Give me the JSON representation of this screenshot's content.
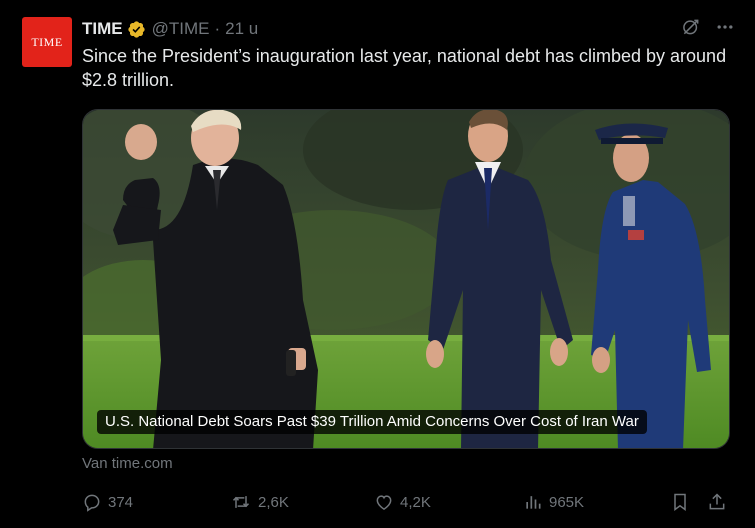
{
  "account": {
    "avatar_text": "TIME",
    "display_name": "TIME",
    "handle": "@TIME",
    "separator": "·",
    "time_ago": "21 u",
    "brand_color": "#e2231a",
    "verified_color": "#e8b829"
  },
  "header_actions": {
    "grok_icon": "grok-icon",
    "more_icon": "more-icon"
  },
  "tweet": {
    "text": "Since the President’s inauguration last year, national debt has climbed by around $2.8 trillion."
  },
  "card": {
    "caption": "U.S. National Debt Soars Past $39 Trillion Amid Concerns Over Cost of Iran War",
    "source": "Van time.com"
  },
  "actions": {
    "replies": "374",
    "reposts": "2,6K",
    "likes": "4,2K",
    "views": "965K"
  },
  "colors": {
    "text": "#e7e9ea",
    "muted": "#71767b",
    "background": "#000000"
  }
}
